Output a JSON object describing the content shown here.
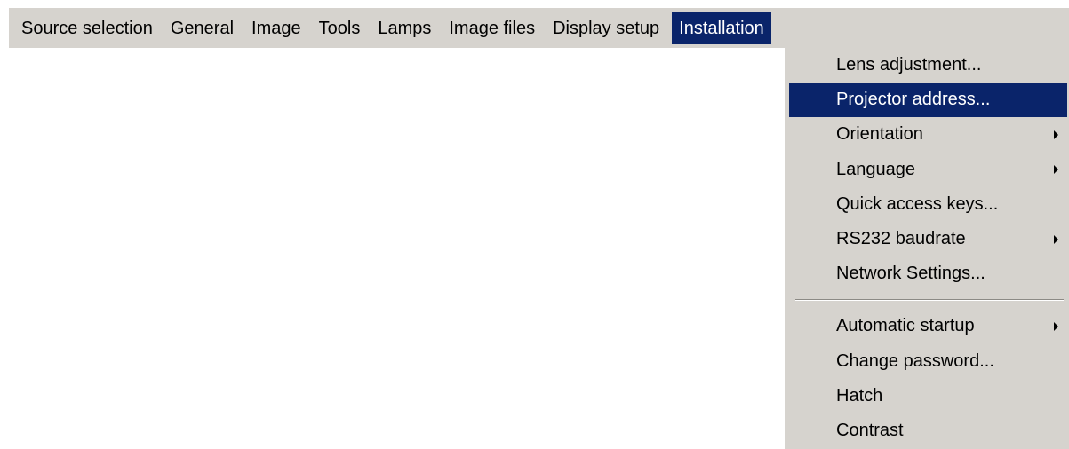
{
  "menubar": {
    "items": [
      {
        "label": "Source selection"
      },
      {
        "label": "General"
      },
      {
        "label": "Image"
      },
      {
        "label": "Tools"
      },
      {
        "label": "Lamps"
      },
      {
        "label": "Image files"
      },
      {
        "label": "Display setup"
      },
      {
        "label": "Installation",
        "active": true
      }
    ]
  },
  "installation_menu": {
    "items": [
      {
        "label": "Lens adjustment...",
        "submenu": false
      },
      {
        "label": "Projector address...",
        "submenu": false,
        "highlighted": true
      },
      {
        "label": "Orientation",
        "submenu": true
      },
      {
        "label": "Language",
        "submenu": true
      },
      {
        "label": "Quick access keys...",
        "submenu": false
      },
      {
        "label": "RS232 baudrate",
        "submenu": true
      },
      {
        "label": "Network Settings...",
        "submenu": false
      },
      {
        "label": "Automatic startup",
        "submenu": true
      },
      {
        "label": "Change password...",
        "submenu": false
      },
      {
        "label": "Hatch",
        "submenu": false
      },
      {
        "label": "Contrast",
        "submenu": false
      }
    ]
  },
  "colors": {
    "menu_background": "#d6d3ce",
    "highlight": "#0a246a",
    "highlight_text": "#ffffff"
  }
}
